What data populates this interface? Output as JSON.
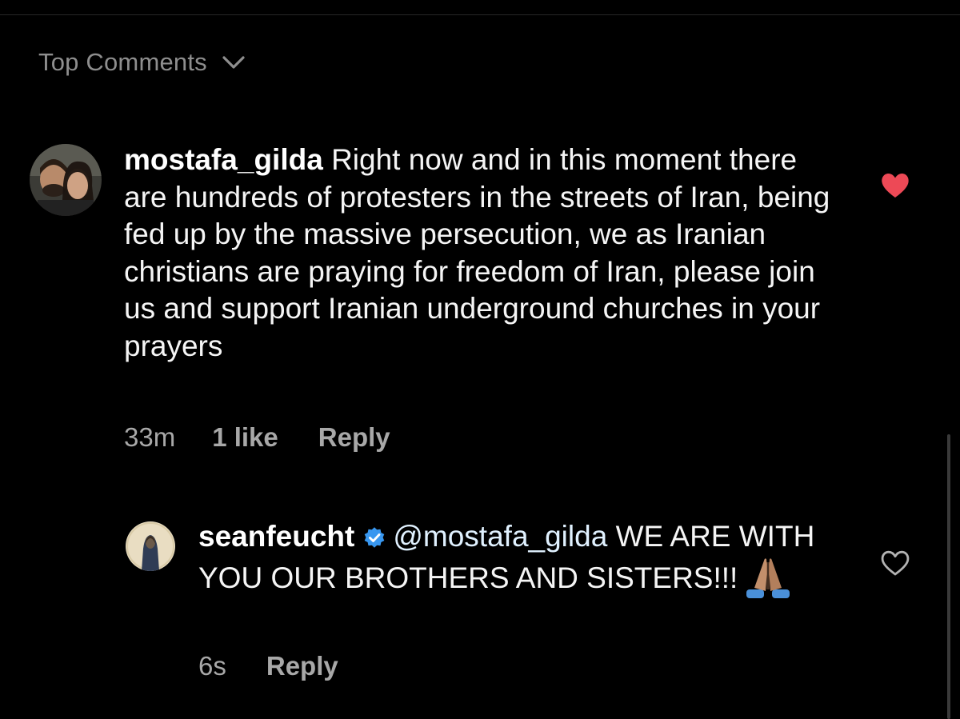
{
  "header": {
    "sort_label": "Top Comments",
    "sort_icon": "chevron-down-icon"
  },
  "comments": [
    {
      "username": "mostafa_gilda",
      "text": "Right now and in this moment there are hundreds of protesters in the streets of Iran, being fed up by the massive persecution, we as Iranian christians are praying for freedom of Iran, please join us and support Iranian underground churches in your prayers",
      "time": "33m",
      "likes": "1 like",
      "reply_label": "Reply",
      "liked": true,
      "heart_color": "#ed4956"
    }
  ],
  "replies": [
    {
      "username": "seanfeucht",
      "verified": true,
      "mention": "@mostafa_gilda",
      "text": "WE ARE WITH YOU OUR BROTHERS AND SISTERS!!!",
      "emoji": "folded-hands-emoji",
      "time": "6s",
      "reply_label": "Reply",
      "liked": false
    }
  ],
  "colors": {
    "background": "#000000",
    "secondary_text": "#a8a8a8",
    "verified_badge": "#3897f0",
    "like_active": "#ed4956"
  }
}
